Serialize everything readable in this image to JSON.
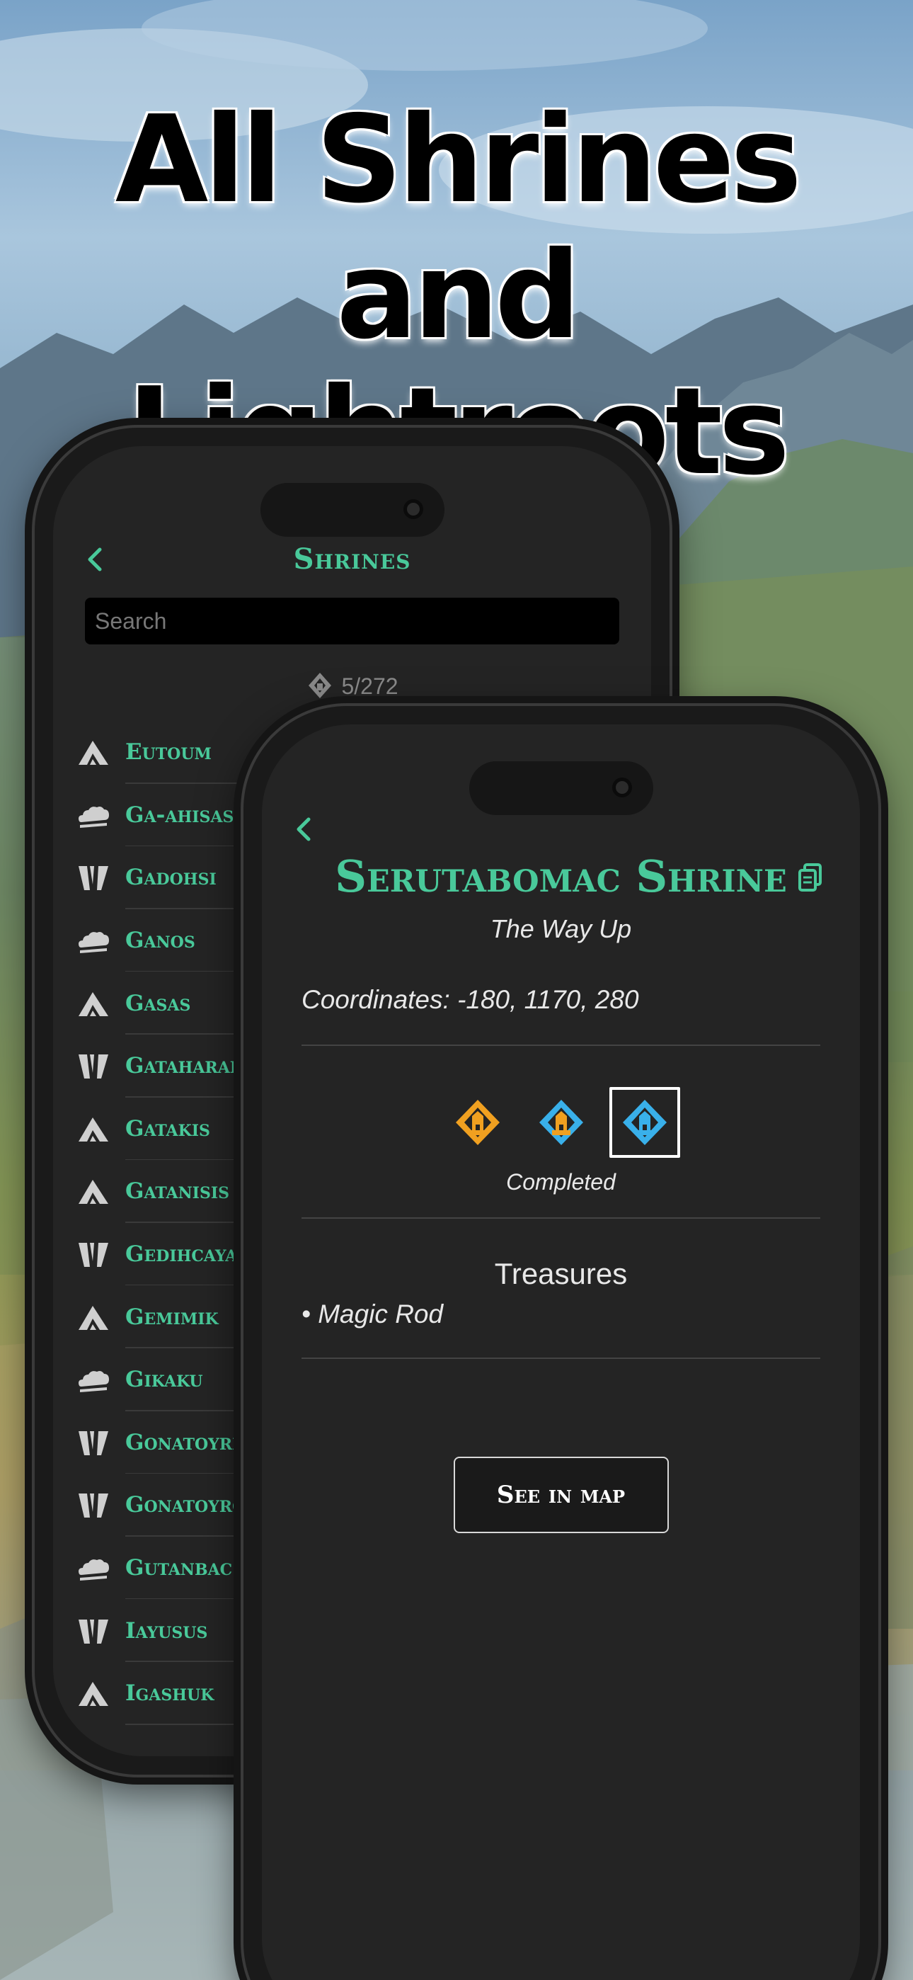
{
  "headline": {
    "line1": "All Shrines and",
    "line2": "Lightroots"
  },
  "list_screen": {
    "title": "Shrines",
    "search_placeholder": "Search",
    "progress": "5/272",
    "items": [
      {
        "name": "Eutoum",
        "region_icon": "mountain-icon"
      },
      {
        "name": "Ga-ahisas",
        "region_icon": "cloud-icon"
      },
      {
        "name": "Gadohsi",
        "region_icon": "canyon-icon"
      },
      {
        "name": "Ganos",
        "region_icon": "cloud-icon"
      },
      {
        "name": "Gasas",
        "region_icon": "mountain-icon"
      },
      {
        "name": "Gataharak",
        "region_icon": "canyon-icon"
      },
      {
        "name": "Gatakis",
        "region_icon": "mountain-icon"
      },
      {
        "name": "Gatanisis",
        "region_icon": "mountain-icon"
      },
      {
        "name": "Gedihcayan",
        "region_icon": "canyon-icon"
      },
      {
        "name": "Gemimik",
        "region_icon": "mountain-icon"
      },
      {
        "name": "Gikaku",
        "region_icon": "cloud-icon"
      },
      {
        "name": "Gonatoyrim",
        "region_icon": "canyon-icon"
      },
      {
        "name": "Gonatoyros",
        "region_icon": "canyon-icon"
      },
      {
        "name": "Gutanbac",
        "region_icon": "cloud-icon"
      },
      {
        "name": "Iayusus",
        "region_icon": "canyon-icon"
      },
      {
        "name": "Igashuk",
        "region_icon": "mountain-icon"
      }
    ]
  },
  "detail_screen": {
    "title": "Serutabomac Shrine",
    "subtitle": "The Way Up",
    "coordinates": "Coordinates: -180, 1170, 280",
    "status_options": [
      {
        "name": "not-visited",
        "color": "#f0a020"
      },
      {
        "name": "visited",
        "color": "#f0a020"
      },
      {
        "name": "completed",
        "color": "#39b0ea"
      }
    ],
    "selected_status": "completed",
    "status_label": "Completed",
    "treasures_heading": "Treasures",
    "treasures": [
      "• Magic Rod"
    ],
    "map_button": "See in map"
  },
  "colors": {
    "accent": "#49c99a",
    "screen_bg": "#242424",
    "orange": "#f0a020",
    "blue": "#39b0ea"
  }
}
